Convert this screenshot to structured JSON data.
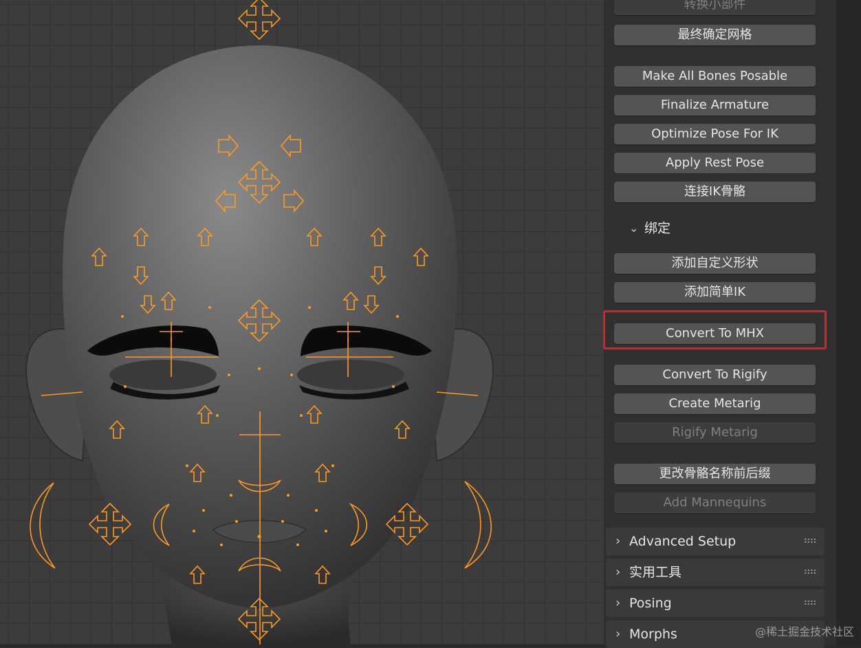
{
  "viewport": {
    "colors": {
      "bone": "#ff9a1f",
      "mesh": "#5a5a5a",
      "eye_socket": "#0b0b0b",
      "grid": "#323232"
    }
  },
  "panel": {
    "buttons_top": [
      {
        "label": "转换小部件",
        "disabled": true
      },
      {
        "label": "最终确定网格",
        "disabled": false
      }
    ],
    "buttons_armature": [
      {
        "label": "Make All Bones Posable",
        "disabled": false
      },
      {
        "label": "Finalize Armature",
        "disabled": false
      },
      {
        "label": "Optimize Pose For IK",
        "disabled": false
      },
      {
        "label": "Apply Rest Pose",
        "disabled": false
      },
      {
        "label": "连接IK骨骼",
        "disabled": false
      }
    ],
    "subsection": {
      "label": "绑定",
      "expanded": true
    },
    "buttons_rig": [
      {
        "label": "添加自定义形状",
        "disabled": false
      },
      {
        "label": "添加简单IK",
        "disabled": false
      },
      {
        "label": "Convert To MHX",
        "disabled": false,
        "highlighted": true
      },
      {
        "label": "Convert To Rigify",
        "disabled": false
      },
      {
        "label": "Create Metarig",
        "disabled": false
      },
      {
        "label": "Rigify Metarig",
        "disabled": true
      },
      {
        "label": "更改骨骼名称前后缀",
        "disabled": false
      },
      {
        "label": "Add Mannequins",
        "disabled": true
      }
    ],
    "sections": [
      {
        "label": "Advanced Setup",
        "expanded": false
      },
      {
        "label": "实用工具",
        "expanded": false
      },
      {
        "label": "Posing",
        "expanded": false
      },
      {
        "label": "Morphs",
        "expanded": false
      }
    ],
    "highlight_color": "#e0201e"
  },
  "watermark": "@稀土掘金技术社区"
}
